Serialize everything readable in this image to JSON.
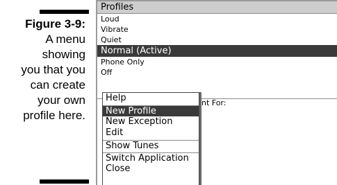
{
  "caption": {
    "figure_label": "Figure 3-9:",
    "lines": [
      "A menu",
      "showing",
      "you that you",
      "can create",
      "your own",
      "profile here."
    ]
  },
  "screen": {
    "header_title": "Profiles",
    "profiles": [
      {
        "label": "Loud",
        "active": false
      },
      {
        "label": "Vibrate",
        "active": false
      },
      {
        "label": "Quiet",
        "active": false
      },
      {
        "label": "Normal (Active)",
        "active": true
      },
      {
        "label": "Phone Only",
        "active": false
      },
      {
        "label": "Off",
        "active": false
      }
    ],
    "behind_label_partial": "nt For:"
  },
  "menu": {
    "items": [
      {
        "label": "Help",
        "selected": false,
        "separator_before": false
      },
      {
        "label": "New Profile",
        "selected": true,
        "separator_before": true
      },
      {
        "label": "New Exception",
        "selected": false,
        "separator_before": false
      },
      {
        "label": "Edit",
        "selected": false,
        "separator_before": false
      },
      {
        "label": "Show Tunes",
        "selected": false,
        "separator_before": true
      },
      {
        "label": "Switch Application",
        "selected": false,
        "separator_before": true
      },
      {
        "label": "Close",
        "selected": false,
        "separator_before": false
      }
    ]
  },
  "colors": {
    "highlight": "#3a3a3a",
    "header_bg": "#cdcdcd"
  }
}
